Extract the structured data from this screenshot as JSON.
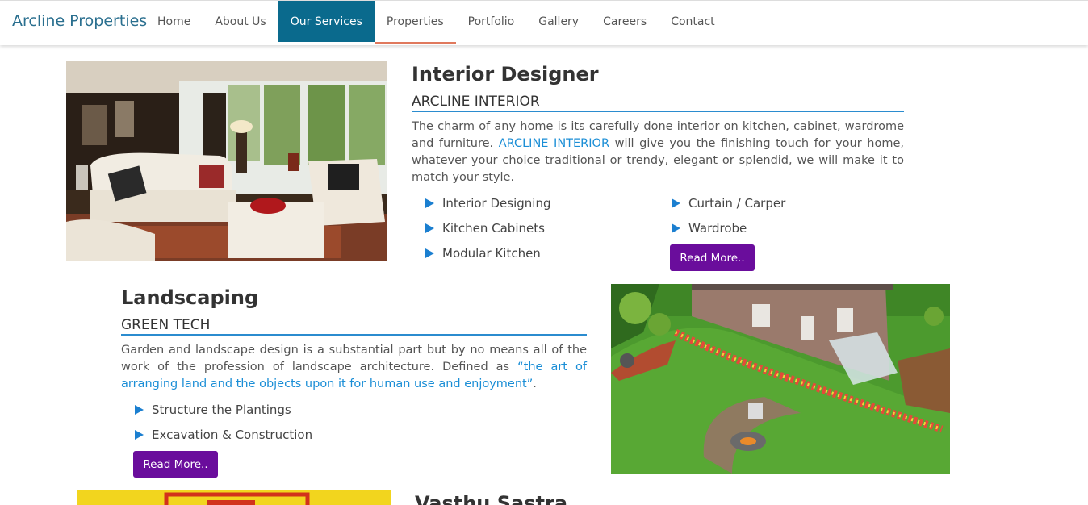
{
  "brand": "Arcline Properties",
  "nav": [
    "Home",
    "About Us",
    "Our Services",
    "Properties",
    "Portfolio",
    "Gallery",
    "Careers",
    "Contact"
  ],
  "interior": {
    "title": "Interior Designer",
    "subtitle": "ARCLINE INTERIOR",
    "text_before": "The charm of any home is its carefully done interior on kitchen, cabinet, wardrome and furniture. ",
    "text_highlight": "ARCLINE INTERIOR",
    "text_after": " will give you the finishing touch for your home, whatever your choice traditional or trendy, elegant or splendid, we will make it to match your style.",
    "list_left": [
      "Interior Designing",
      "Kitchen Cabinets",
      "Modular Kitchen"
    ],
    "list_right": [
      "Curtain / Carper",
      "Wardrobe"
    ],
    "button": "Read More.."
  },
  "landscaping": {
    "title": "Landscaping",
    "subtitle": "GREEN TECH",
    "text_before": "Garden and landscape design is a substantial part but by no means all of the work of the profession of landscape architecture. Defined as ",
    "text_highlight": "“the art of arranging land and the objects upon it for human use and enjoyment”",
    "text_after": ".",
    "list": [
      "Structure the Plantings",
      "Excavation & Construction"
    ],
    "button": "Read More.."
  },
  "vasthu": {
    "title": "Vasthu Sastra"
  }
}
